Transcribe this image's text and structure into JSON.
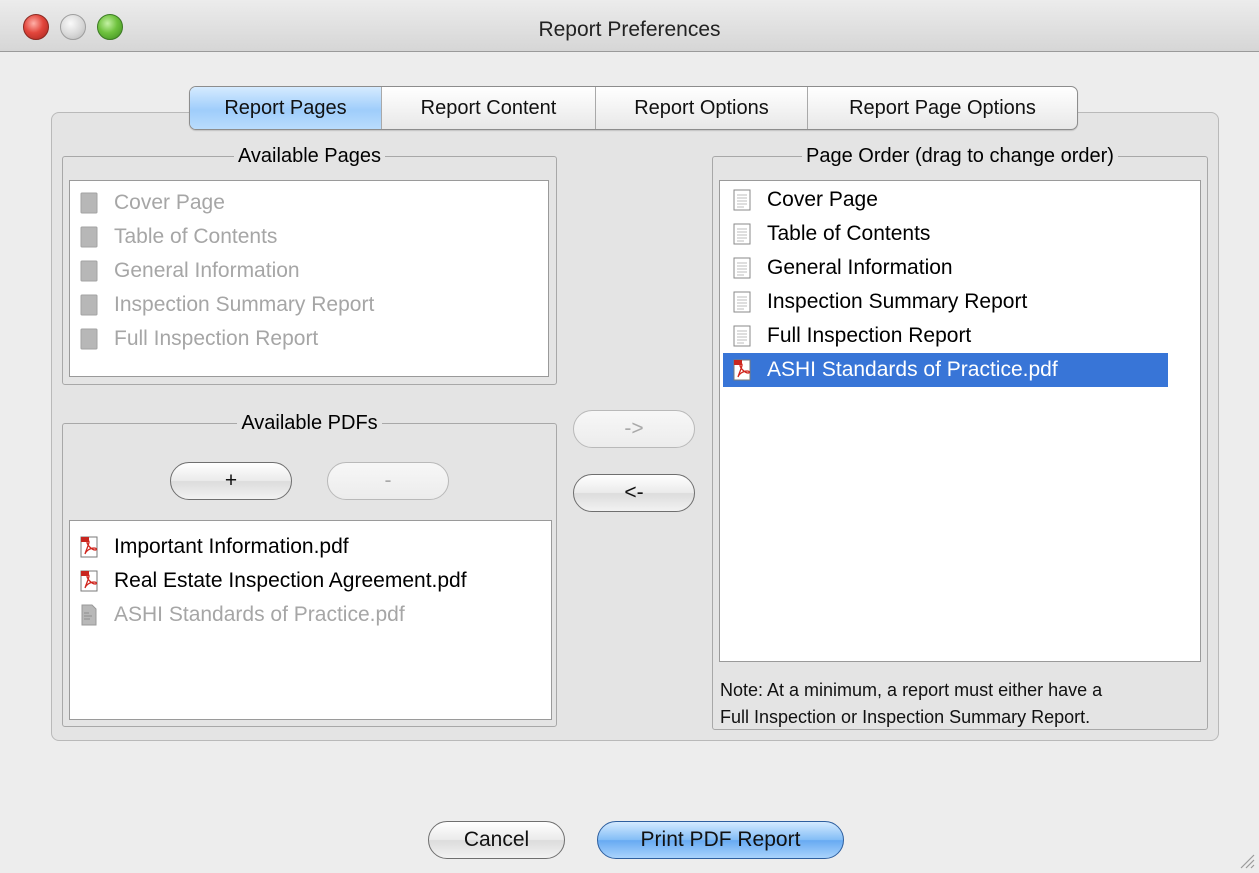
{
  "window": {
    "title": "Report Preferences"
  },
  "tabs": [
    {
      "label": "Report Pages",
      "active": true
    },
    {
      "label": "Report Content",
      "active": false
    },
    {
      "label": "Report Options",
      "active": false
    },
    {
      "label": "Report Page Options",
      "active": false
    }
  ],
  "available_pages": {
    "title": "Available Pages",
    "items": [
      {
        "label": "Cover Page",
        "icon": "page-icon",
        "enabled": false
      },
      {
        "label": "Table of Contents",
        "icon": "page-icon",
        "enabled": false
      },
      {
        "label": "General Information",
        "icon": "page-icon",
        "enabled": false
      },
      {
        "label": "Inspection Summary Report",
        "icon": "page-icon",
        "enabled": false
      },
      {
        "label": "Full Inspection Report",
        "icon": "page-icon",
        "enabled": false
      }
    ]
  },
  "available_pdfs": {
    "title": "Available PDFs",
    "add_label": "+",
    "remove_label": "-",
    "items": [
      {
        "label": "Important Information.pdf",
        "icon": "pdf-icon",
        "enabled": true
      },
      {
        "label": "Real Estate Inspection Agreement.pdf",
        "icon": "pdf-icon",
        "enabled": true
      },
      {
        "label": "ASHI Standards of Practice.pdf",
        "icon": "pdf-icon",
        "enabled": false
      }
    ]
  },
  "transfer": {
    "add_label": "->",
    "remove_label": "<-"
  },
  "page_order": {
    "title": "Page Order (drag to change order)",
    "items": [
      {
        "label": "Cover Page",
        "icon": "page-icon",
        "selected": false
      },
      {
        "label": "Table of Contents",
        "icon": "page-icon",
        "selected": false
      },
      {
        "label": "General Information",
        "icon": "page-icon",
        "selected": false
      },
      {
        "label": "Inspection Summary Report",
        "icon": "page-icon",
        "selected": false
      },
      {
        "label": "Full Inspection Report",
        "icon": "page-icon",
        "selected": false
      },
      {
        "label": "ASHI Standards of Practice.pdf",
        "icon": "pdf-icon",
        "selected": true
      }
    ],
    "note_line1": "Note: At a minimum, a report must either have a",
    "note_line2": "Full Inspection or Inspection Summary Report."
  },
  "footer": {
    "cancel_label": "Cancel",
    "print_label": "Print PDF Report"
  },
  "colors": {
    "selection": "#3875d7",
    "primary_button": "#67aaf2",
    "disabled_text": "#a6a6a6"
  }
}
